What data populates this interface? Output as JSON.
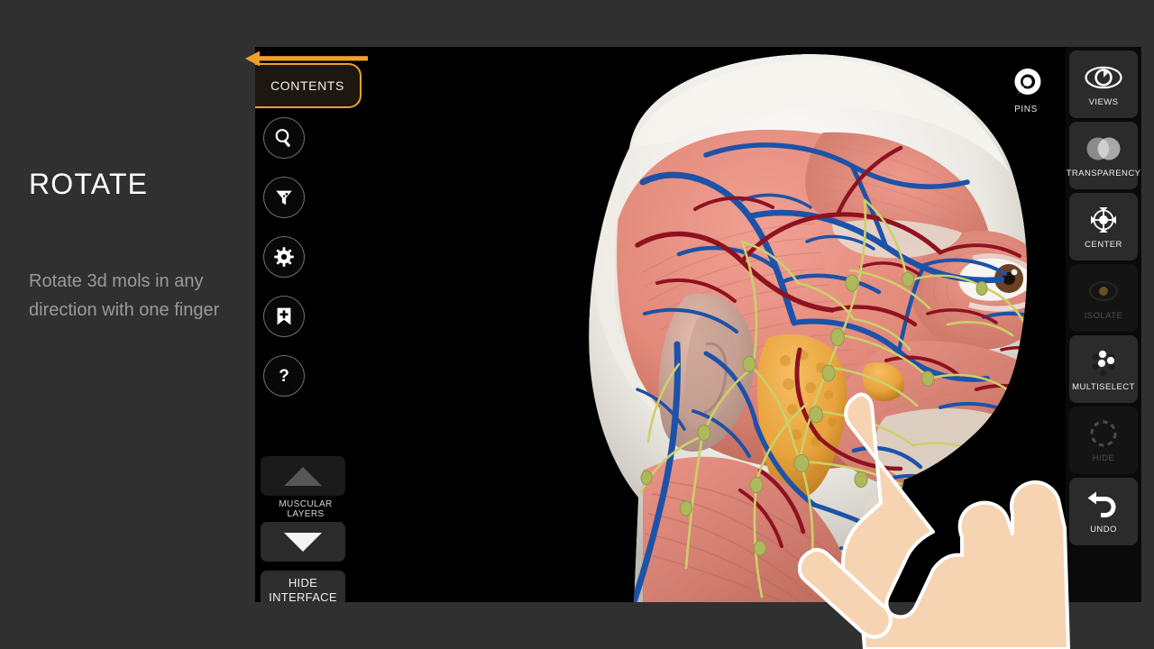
{
  "info_panel": {
    "title": "ROTATE",
    "body": "Rotate 3d mols in any direction with one finger"
  },
  "canvas": {
    "background_color": "#000000",
    "model_description": "3D anatomy model of a human head and neck in lateral view showing facial muscles, veins, arteries, lymphatic vessels and parotid gland"
  },
  "contents_button": {
    "label": "CONTENTS",
    "accent_color": "#f0a02a",
    "arrow_icon": "arrow-left-icon"
  },
  "left_tools": [
    {
      "name": "search",
      "icon": "search-icon"
    },
    {
      "name": "filter",
      "icon": "funnel-icon"
    },
    {
      "name": "settings",
      "icon": "gear-icon"
    },
    {
      "name": "bookmark-add",
      "icon": "bookmark-plus-icon"
    },
    {
      "name": "help",
      "icon": "question-mark-icon"
    }
  ],
  "layers": {
    "up_label": "layer-up",
    "caption": "MUSCULAR LAYERS",
    "down_label": "layer-down",
    "up_icon": "triangle-up-icon",
    "down_icon": "triangle-down-icon",
    "up_enabled": false,
    "down_enabled": true,
    "hide_interface_line1": "HIDE",
    "hide_interface_line2": "INTERFACE"
  },
  "pins": {
    "label": "PINS",
    "icon": "pin-icon"
  },
  "right_tools": [
    {
      "label": "VIEWS",
      "icon": "eye-icon",
      "enabled": true
    },
    {
      "label": "TRANSPARENCY",
      "icon": "two-circles-icon",
      "enabled": true
    },
    {
      "label": "CENTER",
      "icon": "crosshair-icon",
      "enabled": true
    },
    {
      "label": "ISOLATE",
      "icon": "isolate-icon",
      "enabled": false
    },
    {
      "label": "MULTISELECT",
      "icon": "dot-cluster-icon",
      "enabled": true
    },
    {
      "label": "HIDE",
      "icon": "dashed-circle-icon",
      "enabled": false
    },
    {
      "label": "UNDO",
      "icon": "undo-arrow-icon",
      "enabled": true
    }
  ],
  "hand_overlay": {
    "name": "pointing-hand-illustration",
    "skin_color": "#f6d4b2",
    "outline_color": "#ffffff"
  },
  "colors": {
    "page_background": "#303030",
    "sidebar_background": "#0a0a0a",
    "accent": "#f0a02a",
    "muscle": "#e2897a",
    "vein": "#1d52a8",
    "artery": "#8e1220",
    "nerve": "#cbd06a",
    "gland": "#e8a33c",
    "bone": "#e9e7e0",
    "cartilage": "#7fa8a6"
  }
}
